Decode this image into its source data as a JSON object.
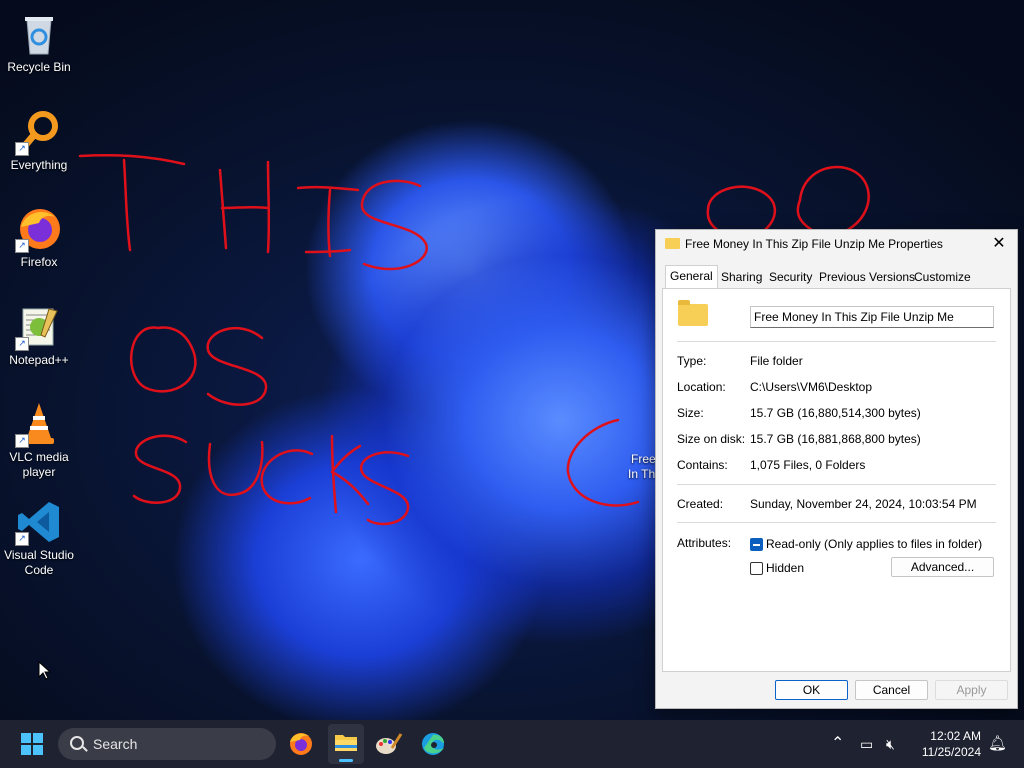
{
  "desktop": {
    "icons": [
      {
        "label": "Recycle Bin",
        "icon": "recycle-bin-icon"
      },
      {
        "label": "Everything",
        "icon": "everything-search-icon"
      },
      {
        "label": "Firefox",
        "icon": "firefox-icon"
      },
      {
        "label": "Notepad++",
        "icon": "notepadpp-icon"
      },
      {
        "label": "VLC media player",
        "icon": "vlc-icon"
      },
      {
        "label": "Visual Studio Code",
        "icon": "vscode-icon"
      }
    ],
    "partial_icon_label_line1": "Free",
    "partial_icon_label_line2": "In Th",
    "scribble_color": "#e0101a",
    "scribble_text": "THIS OS SUCKS"
  },
  "dialog": {
    "title": "Free Money In This Zip File Unzip Me Properties",
    "close_glyph": "✕",
    "tabs": [
      {
        "label": "General",
        "active": true
      },
      {
        "label": "Sharing"
      },
      {
        "label": "Security"
      },
      {
        "label": "Previous Versions"
      },
      {
        "label": "Customize"
      }
    ],
    "name_value": "Free Money In This Zip File Unzip Me",
    "fields": {
      "type_label": "Type:",
      "type_value": "File folder",
      "location_label": "Location:",
      "location_value": "C:\\Users\\VM6\\Desktop",
      "size_label": "Size:",
      "size_value": "15.7 GB (16,880,514,300 bytes)",
      "sizeondisk_label": "Size on disk:",
      "sizeondisk_value": "15.7 GB (16,881,868,800 bytes)",
      "contains_label": "Contains:",
      "contains_value": "1,075 Files, 0 Folders",
      "created_label": "Created:",
      "created_value": "Sunday, November 24, 2024, 10:03:54 PM",
      "attributes_label": "Attributes:"
    },
    "attributes": {
      "readonly_label": "Read-only (Only applies to files in folder)",
      "readonly_state": "indeterminate",
      "hidden_label": "Hidden",
      "hidden_state": "unchecked",
      "advanced_label": "Advanced..."
    },
    "buttons": {
      "ok": "OK",
      "cancel": "Cancel",
      "apply": "Apply"
    }
  },
  "taskbar": {
    "search_label": "Search",
    "apps": [
      "firefox-icon",
      "file-explorer-icon",
      "paint-icon",
      "edge-icon"
    ],
    "time": "12:02 AM",
    "date": "11/25/2024"
  },
  "colors": {
    "accent": "#0a64c8",
    "taskbar_accent": "#4cc2ff"
  }
}
